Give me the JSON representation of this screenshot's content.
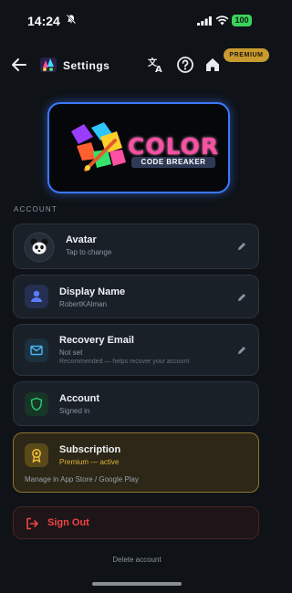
{
  "status_bar": {
    "time": "14:24",
    "battery": "100"
  },
  "header": {
    "title": "Settings",
    "premium_badge": "PREMIUM"
  },
  "logo": {
    "word": "COLOR",
    "subtitle": "CODE BREAKER"
  },
  "section": {
    "label": "ACCOUNT"
  },
  "rows": {
    "avatar": {
      "title": "Avatar",
      "subtitle": "Tap to change"
    },
    "display_name": {
      "title": "Display Name",
      "subtitle": "RobertKAlman"
    },
    "recovery_email": {
      "title": "Recovery Email",
      "subtitle": "Not set",
      "note": "Recommended — helps recover your account"
    },
    "account": {
      "title": "Account",
      "subtitle": "Signed in"
    }
  },
  "subscription": {
    "title": "Subscription",
    "status": "Premium — active",
    "manage": "Manage in App Store / Google Play"
  },
  "sign_out": {
    "label": "Sign Out"
  },
  "delete_account": {
    "label": "Delete account"
  },
  "colors": {
    "accent_blue": "#3b78ff",
    "premium_gold": "#c89b2f",
    "danger_red": "#f04448",
    "success_green": "#2ecc71"
  },
  "icons": [
    "bell-slash-icon",
    "back-arrow-icon",
    "translate-icon",
    "help-icon",
    "home-icon",
    "panda-icon",
    "person-icon",
    "envelope-icon",
    "shield-icon",
    "medal-icon",
    "pencil-icon",
    "sign-out-icon"
  ]
}
